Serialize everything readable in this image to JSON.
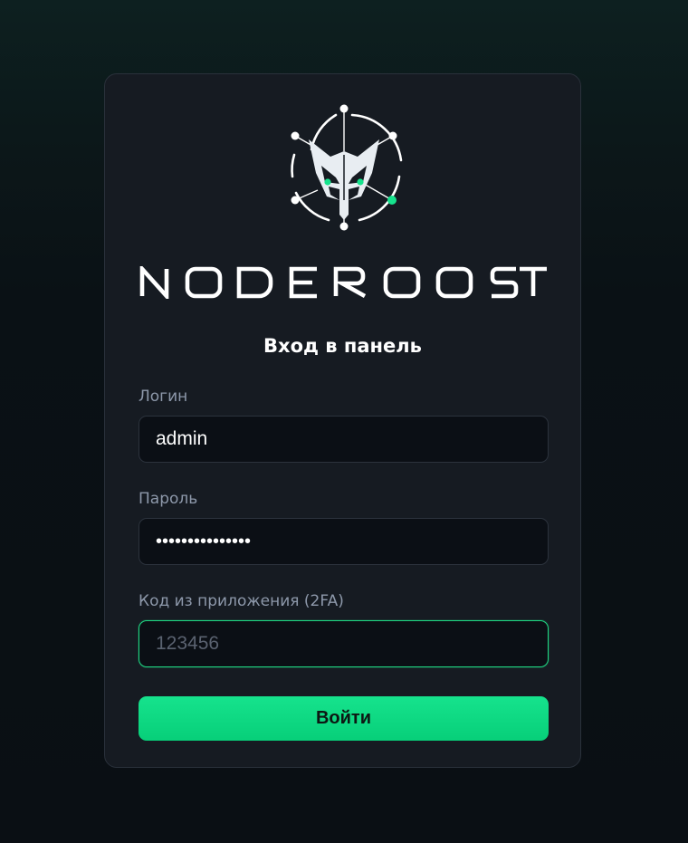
{
  "brand": {
    "name": "NODEROOST",
    "colors": {
      "accent": "#10d982",
      "card_background": "#161b22",
      "page_background": "#0a0f14"
    }
  },
  "login": {
    "title": "Вход в панель",
    "username": {
      "label": "Логин",
      "value": "admin"
    },
    "password": {
      "label": "Пароль",
      "value": "•••••••••••••••"
    },
    "otp": {
      "label": "Код из приложения (2FA)",
      "placeholder": "123456",
      "value": ""
    },
    "submit_label": "Войти"
  }
}
